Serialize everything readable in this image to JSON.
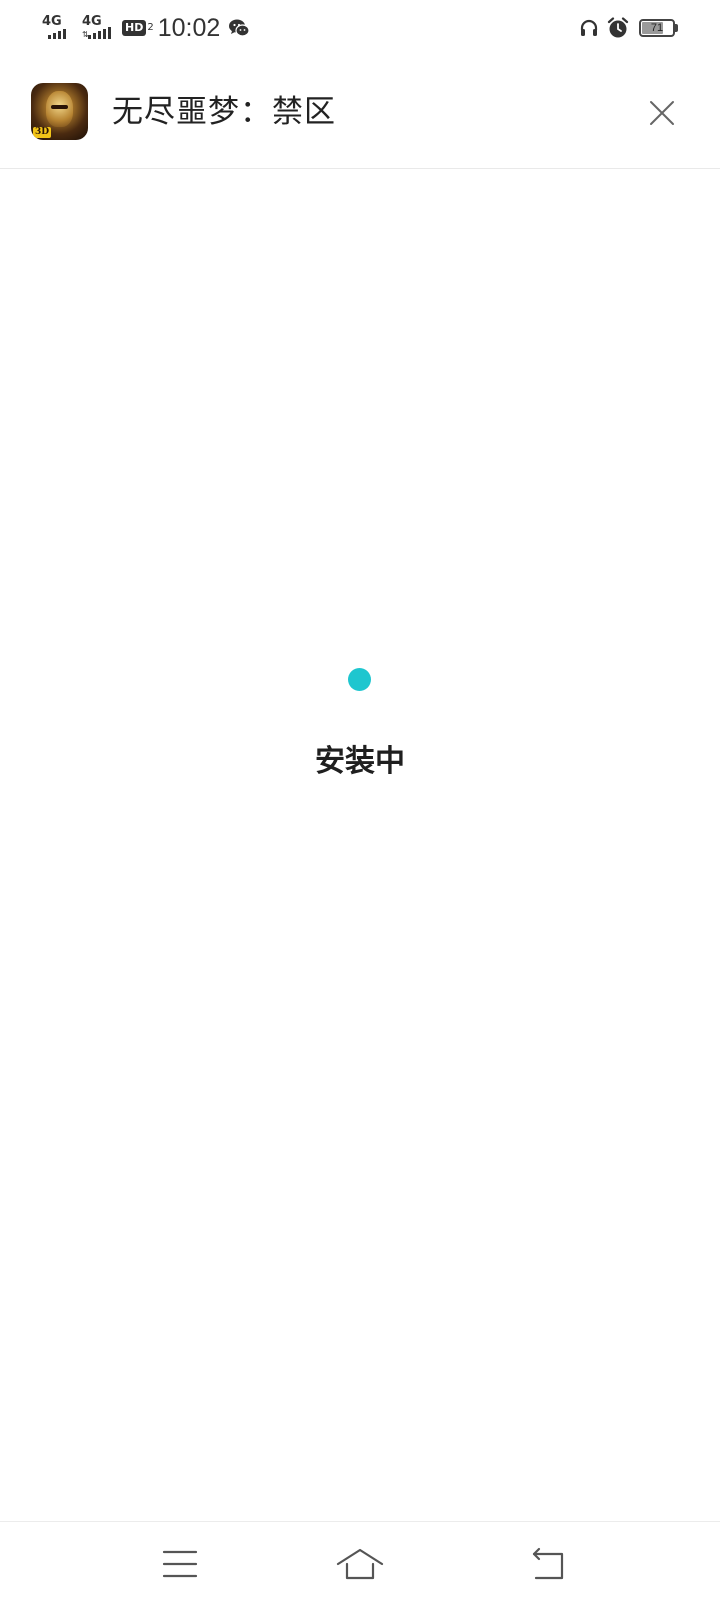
{
  "status_bar": {
    "sim1_network": "4G",
    "sim2_network": "4G",
    "hd_badge": "HD",
    "hd_sub": "2",
    "time": "10:02",
    "battery_level": "71",
    "battery_fraction": 0.71
  },
  "header": {
    "app_name": "无尽噩梦：禁区",
    "app_icon_tag": "3D"
  },
  "content": {
    "status_text": "安装中",
    "accent_color": "#1ec6cf"
  },
  "icons": {
    "close": "close-icon",
    "menu": "menu-icon",
    "home": "home-icon",
    "back": "back-icon",
    "wechat": "wechat-icon",
    "headphones": "headphones-icon",
    "alarm": "alarm-icon"
  }
}
